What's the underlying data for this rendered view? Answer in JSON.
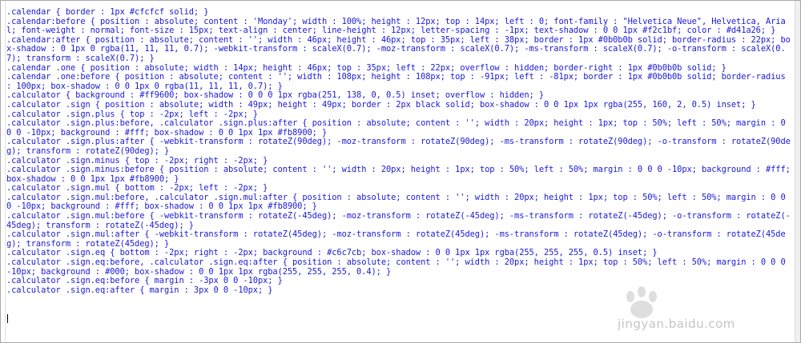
{
  "editor": {
    "lines": [
      ".calendar { border : 1px #cfcfcf solid; }",
      ".calendar:before { position : absolute; content : 'Monday'; width : 100%; height : 12px; top : 14px; left : 0; font-family : \"Helvetica Neue\", Helvetica, Arial; font-weight : normal; font-size : 15px; text-align : center; line-height : 12px; letter-spacing : -1px; text-shadow : 0 0 1px #f2c1bf; color : #d41a26; }",
      ".calendar:after { position : absolute; content : ''; width : 46px; height : 46px; top : 35px; left : 38px; border : 1px #0b0b0b solid; border-radius : 22px; box-shadow : 0 1px 0 rgba(11, 11, 11, 0.7); -webkit-transform : scaleX(0.7); -moz-transform : scaleX(0.7); -ms-transform : scaleX(0.7); -o-transform : scaleX(0.7); transform : scaleX(0.7); }",
      ".calendar .one { position : absolute; width : 14px; height : 46px; top : 35px; left : 22px; overflow : hidden; border-right : 1px #0b0b0b solid; }",
      ".calendar .one:before { position : absolute; content : ''; width : 108px; height : 108px; top : -91px; left : -81px; border : 1px #0b0b0b solid; border-radius : 100px; box-shadow : 0 0 1px 0 rgba(11, 11, 11, 0.7); }",
      ".calculator { background : #ff9600; box-shadow : 0 0 0 1px rgba(251, 138, 0, 0.5) inset; overflow : hidden; }",
      ".calculator .sign { position : absolute; width : 49px; height : 49px; border : 2px black solid; box-shadow : 0 0 1px 1px rgba(255, 160, 2, 0.5) inset; }",
      ".calculator .sign.plus { top : -2px; left : -2px; }",
      ".calculator .sign.plus:before, .calculator .sign.plus:after { position : absolute; content : ''; width : 20px; height : 1px; top : 50%; left : 50%; margin : 0 0 0 -10px; background : #fff; box-shadow : 0 0 1px 1px #fb8900; }",
      ".calculator .sign.plus:after { -webkit-transform : rotateZ(90deg); -moz-transform : rotateZ(90deg); -ms-transform : rotateZ(90deg); -o-transform : rotateZ(90deg); transform : rotateZ(90deg); }",
      ".calculator .sign.minus { top : -2px; right : -2px; }",
      ".calculator .sign.minus:before { position : absolute; content : ''; width : 20px; height : 1px; top : 50%; left : 50%; margin : 0 0 0 -10px; background : #fff; box-shadow : 0 0 1px 1px #fb8900; }",
      ".calculator .sign.mul { bottom : -2px; left : -2px; }",
      ".calculator .sign.mul:before, .calculator .sign.mul:after { position : absolute; content : ''; width : 20px; height : 1px; top : 50%; left : 50%; margin : 0 0 0 -10px; background : #fff; box-shadow : 0 0 1px 1px #fb8900; }",
      ".calculator .sign.mul:before { -webkit-transform : rotateZ(-45deg); -moz-transform : rotateZ(-45deg); -ms-transform : rotateZ(-45deg); -o-transform : rotateZ(-45deg); transform : rotateZ(-45deg); }",
      ".calculator .sign.mul:after { -webkit-transform : rotateZ(45deg); -moz-transform : rotateZ(45deg); -ms-transform : rotateZ(45deg); -o-transform : rotateZ(45deg); transform : rotateZ(45deg); }",
      ".calculator .sign.eq { bottom : -2px; right : -2px; background : #c6c7cb; box-shadow : 0 0 1px 1px rgba(255, 255, 255, 0.5) inset; }",
      ".calculator .sign.eq:before, .calculator .sign.eq:after { position : absolute; content : ''; width : 20px; height : 1px; top : 50%; left : 50%; margin : 0 0 0 -10px; background : #000; box-shadow : 0 0 1px 1px rgba(255, 255, 255, 0.4); }",
      ".calculator .sign.eq:before { margin : -3px 0 0 -10px; }",
      ".calculator .sign.eq:after { margin : 3px 0 0 -10px; }"
    ]
  },
  "watermark": {
    "logo": "Baidu 经验",
    "url": "jingyan.baidu.com"
  },
  "colors": {
    "code_text": "#1a1ad6",
    "background": "#ffffff"
  }
}
